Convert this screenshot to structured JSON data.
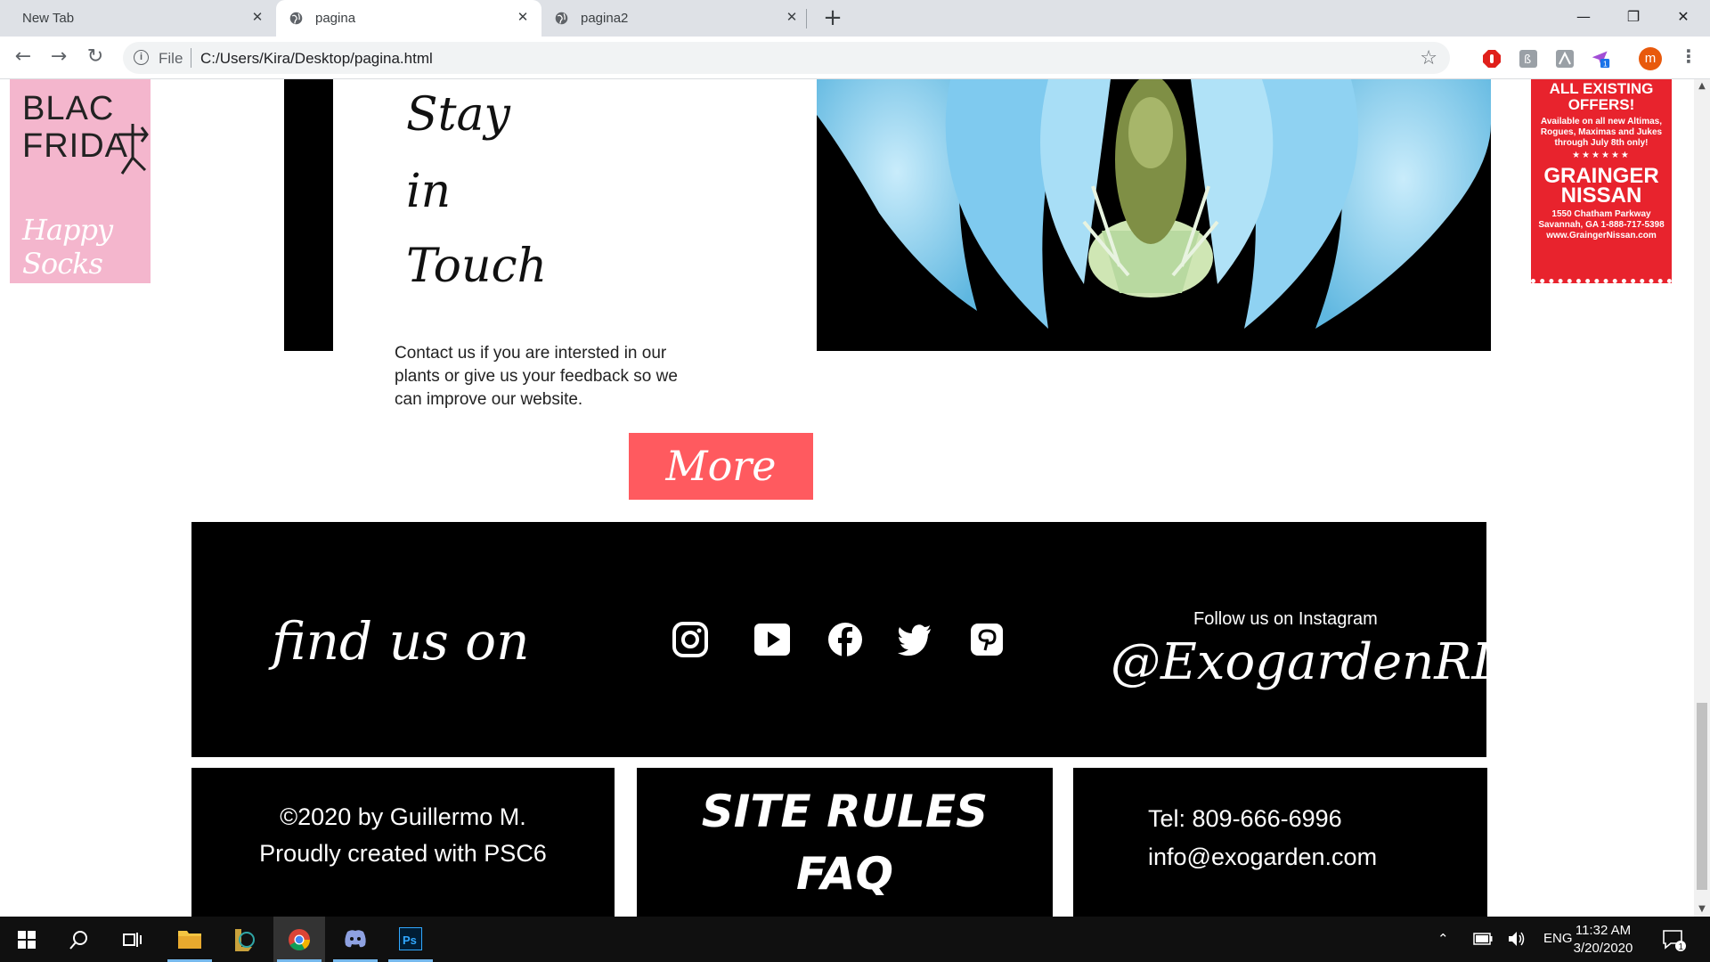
{
  "browser": {
    "tabs": [
      {
        "title": "New Tab"
      },
      {
        "title": "pagina"
      },
      {
        "title": "pagina2"
      }
    ],
    "new_tab_symbol": "+",
    "window_controls": {
      "minimize": "—",
      "restore": "❐",
      "close": "✕"
    },
    "address_bar": {
      "scheme": "File",
      "url": "C:/Users/Kira/Desktop/pagina.html"
    },
    "profile_initial": "m",
    "extensions": [
      "adblock-icon",
      "translate-icon",
      "pdf-icon",
      "send-icon"
    ],
    "extension_badge": "1"
  },
  "ads": {
    "left": {
      "line1": "BLAC",
      "line2": "FRIDA",
      "brand": "Happy Socks"
    },
    "right": {
      "headline": "ALL EXISTING OFFERS!",
      "fine": "Available on all new Altimas, Rogues, Maximas and Jukes through July 8th only!",
      "stars": "★★★★★★",
      "dealer": "GRAINGER NISSAN",
      "address": "1550 Chatham Parkway Savannah, GA 1-888-717-5398 www.GraingerNissan.com"
    }
  },
  "content": {
    "stay_lines": [
      "Stay",
      "in",
      "Touch"
    ],
    "contact_text": "Contact us if you are intersted in our plants or give us your feedback so we can improve our website.",
    "more_button": "More"
  },
  "footer": {
    "find_us": "find us on",
    "social": [
      "instagram-icon",
      "youtube-icon",
      "facebook-icon",
      "twitter-icon",
      "pinterest-icon"
    ],
    "follow_label": "Follow us on Instagram",
    "handle": "@ExogardenRD",
    "copyright_line1": "©2020 by Guillermo M.",
    "copyright_line2": "Proudly created with PSC6",
    "site_rules": "SITE RULES",
    "faq": "FAQ",
    "tel": "Tel: 809-666-6996",
    "email": "info@exogarden.com"
  },
  "taskbar": {
    "apps": [
      "start-icon",
      "search-icon",
      "task-view-icon",
      "file-explorer-icon",
      "league-icon",
      "chrome-icon",
      "discord-icon",
      "photoshop-icon"
    ],
    "language": "ENG",
    "time": "11:32 AM",
    "date": "3/20/2020",
    "notification_count": "1"
  },
  "colors": {
    "more_button": "#ff5a5f",
    "footer": "#000000",
    "ad_pink": "#f4b6cd",
    "ad_red": "#e8232d"
  }
}
